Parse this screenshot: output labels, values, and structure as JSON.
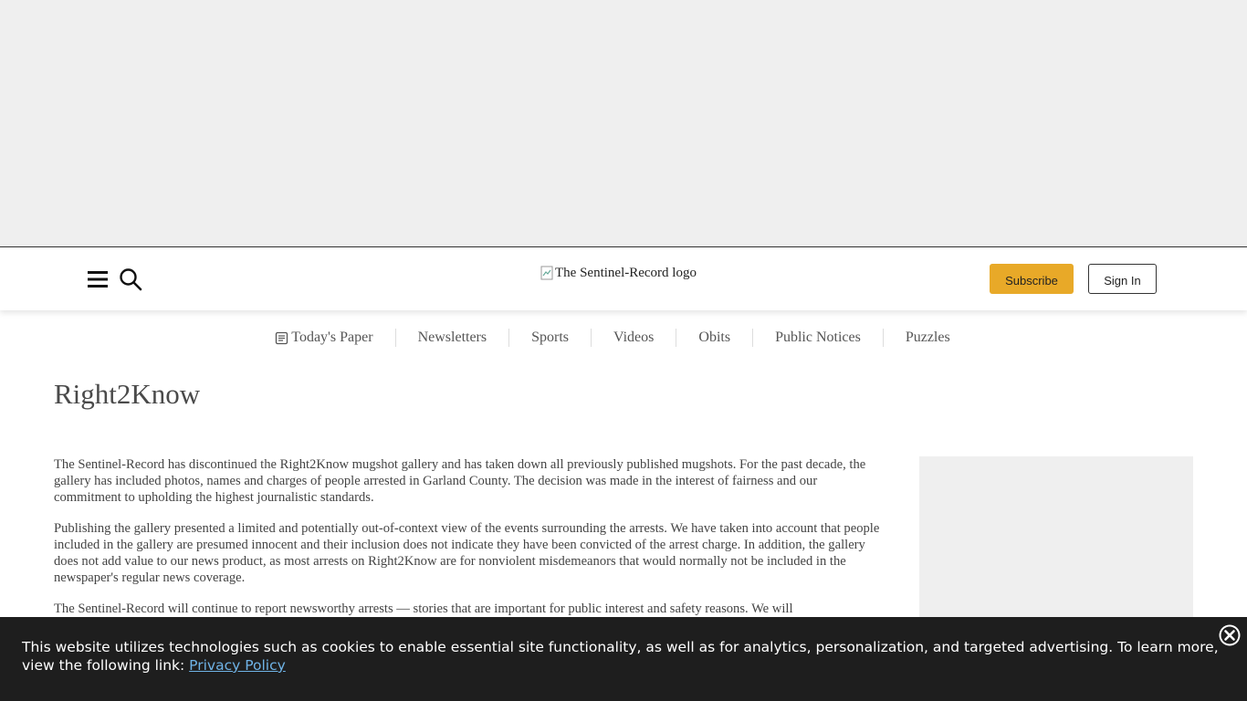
{
  "header": {
    "logo_alt": "The Sentinel-Record logo",
    "subscribe_label": "Subscribe",
    "signin_label": "Sign In",
    "icons": {
      "menu": "hamburger-menu-icon",
      "search": "search-icon"
    }
  },
  "nav": {
    "items": [
      {
        "label": "Today's Paper",
        "icon": "newspaper-icon"
      },
      {
        "label": "Newsletters"
      },
      {
        "label": "Sports"
      },
      {
        "label": "Videos"
      },
      {
        "label": "Obits"
      },
      {
        "label": "Public Notices"
      },
      {
        "label": "Puzzles"
      }
    ]
  },
  "page": {
    "title": "Right2Know"
  },
  "article": {
    "paragraphs": [
      "The Sentinel-Record has discontinued the Right2Know mugshot gallery and has taken down all previously published mugshots. For the past decade, the gallery has included photos, names and charges of people arrested in Garland County. The decision was made in the interest of fairness and our commitment to upholding the highest journalistic standards.",
      "Publishing the gallery presented a limited and potentially out-of-context view of the events surrounding the arrests. We have taken into account that people included in the gallery are presumed innocent and their inclusion does not indicate they have been convicted of the arrest charge. In addition, the gallery does not add value to our news product, as most arrests on Right2Know are for nonviolent misdemeanors that would normally not be included in the newspaper's regular news coverage.",
      "The Sentinel-Record will continue to report newsworthy arrests — stories that are important for public interest and safety reasons. We will"
    ]
  },
  "cookie": {
    "text": "This website utilizes technologies such as cookies to enable essential site functionality, as well as for analytics, personalization, and targeted advertising. To learn more, view the following link: ",
    "link_label": "Privacy Policy",
    "close_icon": "close-icon"
  },
  "colors": {
    "subscribe_bg": "#e8a928",
    "ad_bg": "#efefef",
    "cookie_bg": "#1e1e1e",
    "link": "#6fb3e6"
  }
}
